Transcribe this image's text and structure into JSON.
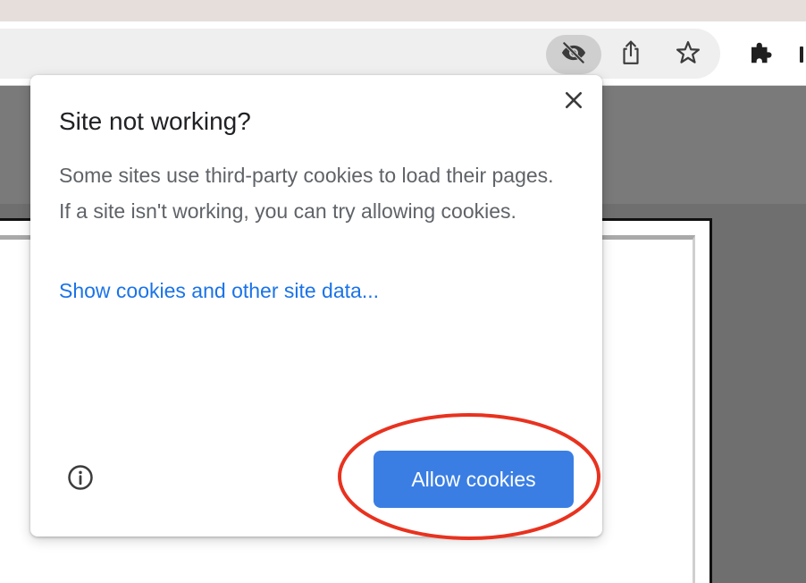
{
  "browser": {
    "toolbar": {
      "icons": [
        "eye-slash-icon",
        "share-icon",
        "star-icon",
        "puzzle-icon"
      ]
    }
  },
  "popup": {
    "title": "Site not working?",
    "body": "Some sites use third-party cookies to load their pages. If a site isn't working, you can try allowing cookies.",
    "link_label": "Show cookies and other site data...",
    "allow_button_label": "Allow cookies",
    "icons": [
      "close-icon",
      "info-icon"
    ]
  },
  "colors": {
    "accent": "#1a73e8",
    "button": "#3a7ee4",
    "highlight": "#e8321f",
    "title": "#202124",
    "body": "#5f6368"
  }
}
